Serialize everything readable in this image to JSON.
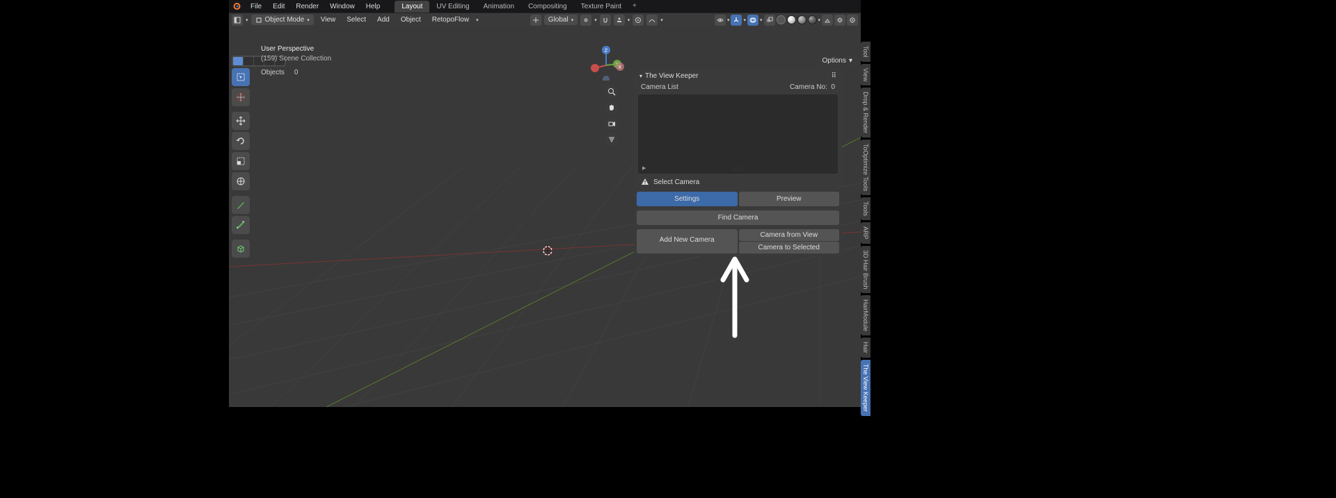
{
  "menubar": {
    "items": [
      "File",
      "Edit",
      "Render",
      "Window",
      "Help"
    ]
  },
  "workspaces": {
    "tabs": [
      "Layout",
      "UV Editing",
      "Animation",
      "Compositing",
      "Texture Paint"
    ],
    "active": 0
  },
  "header": {
    "mode": "Object Mode",
    "menus": [
      "View",
      "Select",
      "Add",
      "Object",
      "RetopoFlow"
    ],
    "orientation": "Global",
    "options_label": "Options"
  },
  "overlay": {
    "perspective": "User Perspective",
    "collection": "(159) Scene Collection",
    "stats_label": "Objects",
    "stats_value": "0"
  },
  "right_tabs": [
    "Tool",
    "View",
    "Drop & Render",
    "ToOptimize Tools",
    "Tools",
    "ARP",
    "3D Hair Brush",
    "HairModule",
    "Hair",
    "The View Keeper"
  ],
  "right_tab_active": 9,
  "panel": {
    "title": "The View Keeper",
    "camera_list_label": "Camera List",
    "camera_no_label": "Camera No:",
    "camera_no_value": "0",
    "select_camera": "Select Camera",
    "settings_btn": "Settings",
    "preview_btn": "Preview",
    "find_camera_btn": "Find Camera",
    "add_camera_btn": "Add New Camera",
    "camera_from_view_btn": "Camera from View",
    "camera_to_selected_btn": "Camera to Selected"
  },
  "gizmo": {
    "axes": [
      "X",
      "Y",
      "Z"
    ]
  }
}
